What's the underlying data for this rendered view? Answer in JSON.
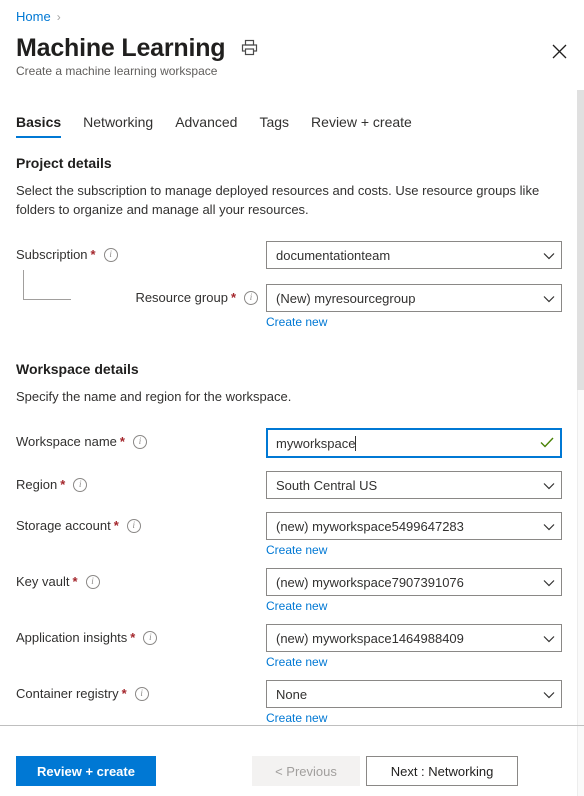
{
  "breadcrumb": {
    "home": "Home",
    "separator": "›"
  },
  "header": {
    "title": "Machine Learning",
    "subtitle": "Create a machine learning workspace",
    "print_icon": "printer-icon",
    "close_icon": "close-icon"
  },
  "tabs": [
    {
      "label": "Basics",
      "active": true
    },
    {
      "label": "Networking",
      "active": false
    },
    {
      "label": "Advanced",
      "active": false
    },
    {
      "label": "Tags",
      "active": false
    },
    {
      "label": "Review + create",
      "active": false
    }
  ],
  "project_details": {
    "heading": "Project details",
    "description": "Select the subscription to manage deployed resources and costs. Use resource groups like folders to organize and manage all your resources.",
    "fields": [
      {
        "label": "Subscription",
        "required": "*",
        "value": "documentationteam",
        "type": "select",
        "create_new": null
      },
      {
        "label": "Resource group",
        "required": "*",
        "value": "(New) myresourcegroup",
        "type": "select",
        "create_new": "Create new"
      }
    ]
  },
  "workspace_details": {
    "heading": "Workspace details",
    "description": "Specify the name and region for the workspace.",
    "fields": [
      {
        "label": "Workspace name",
        "required": "*",
        "value": "myworkspace",
        "type": "text",
        "focused": true,
        "valid": true,
        "create_new": null
      },
      {
        "label": "Region",
        "required": "*",
        "value": "South Central US",
        "type": "select",
        "create_new": null
      },
      {
        "label": "Storage account",
        "required": "*",
        "value": "(new) myworkspace5499647283",
        "type": "select",
        "create_new": "Create new"
      },
      {
        "label": "Key vault",
        "required": "*",
        "value": "(new) myworkspace7907391076",
        "type": "select",
        "create_new": "Create new"
      },
      {
        "label": "Application insights",
        "required": "*",
        "value": "(new) myworkspace1464988409",
        "type": "select",
        "create_new": "Create new"
      },
      {
        "label": "Container registry",
        "required": "*",
        "value": "None",
        "type": "select",
        "create_new": "Create new"
      }
    ]
  },
  "footer": {
    "review_create": "Review + create",
    "previous": "< Previous",
    "next": "Next : Networking"
  },
  "colors": {
    "accent": "#0078d4",
    "required_asterisk": "#a4262c",
    "valid_check": "#498205",
    "link": "#0078d4",
    "border": "#8a8886"
  }
}
